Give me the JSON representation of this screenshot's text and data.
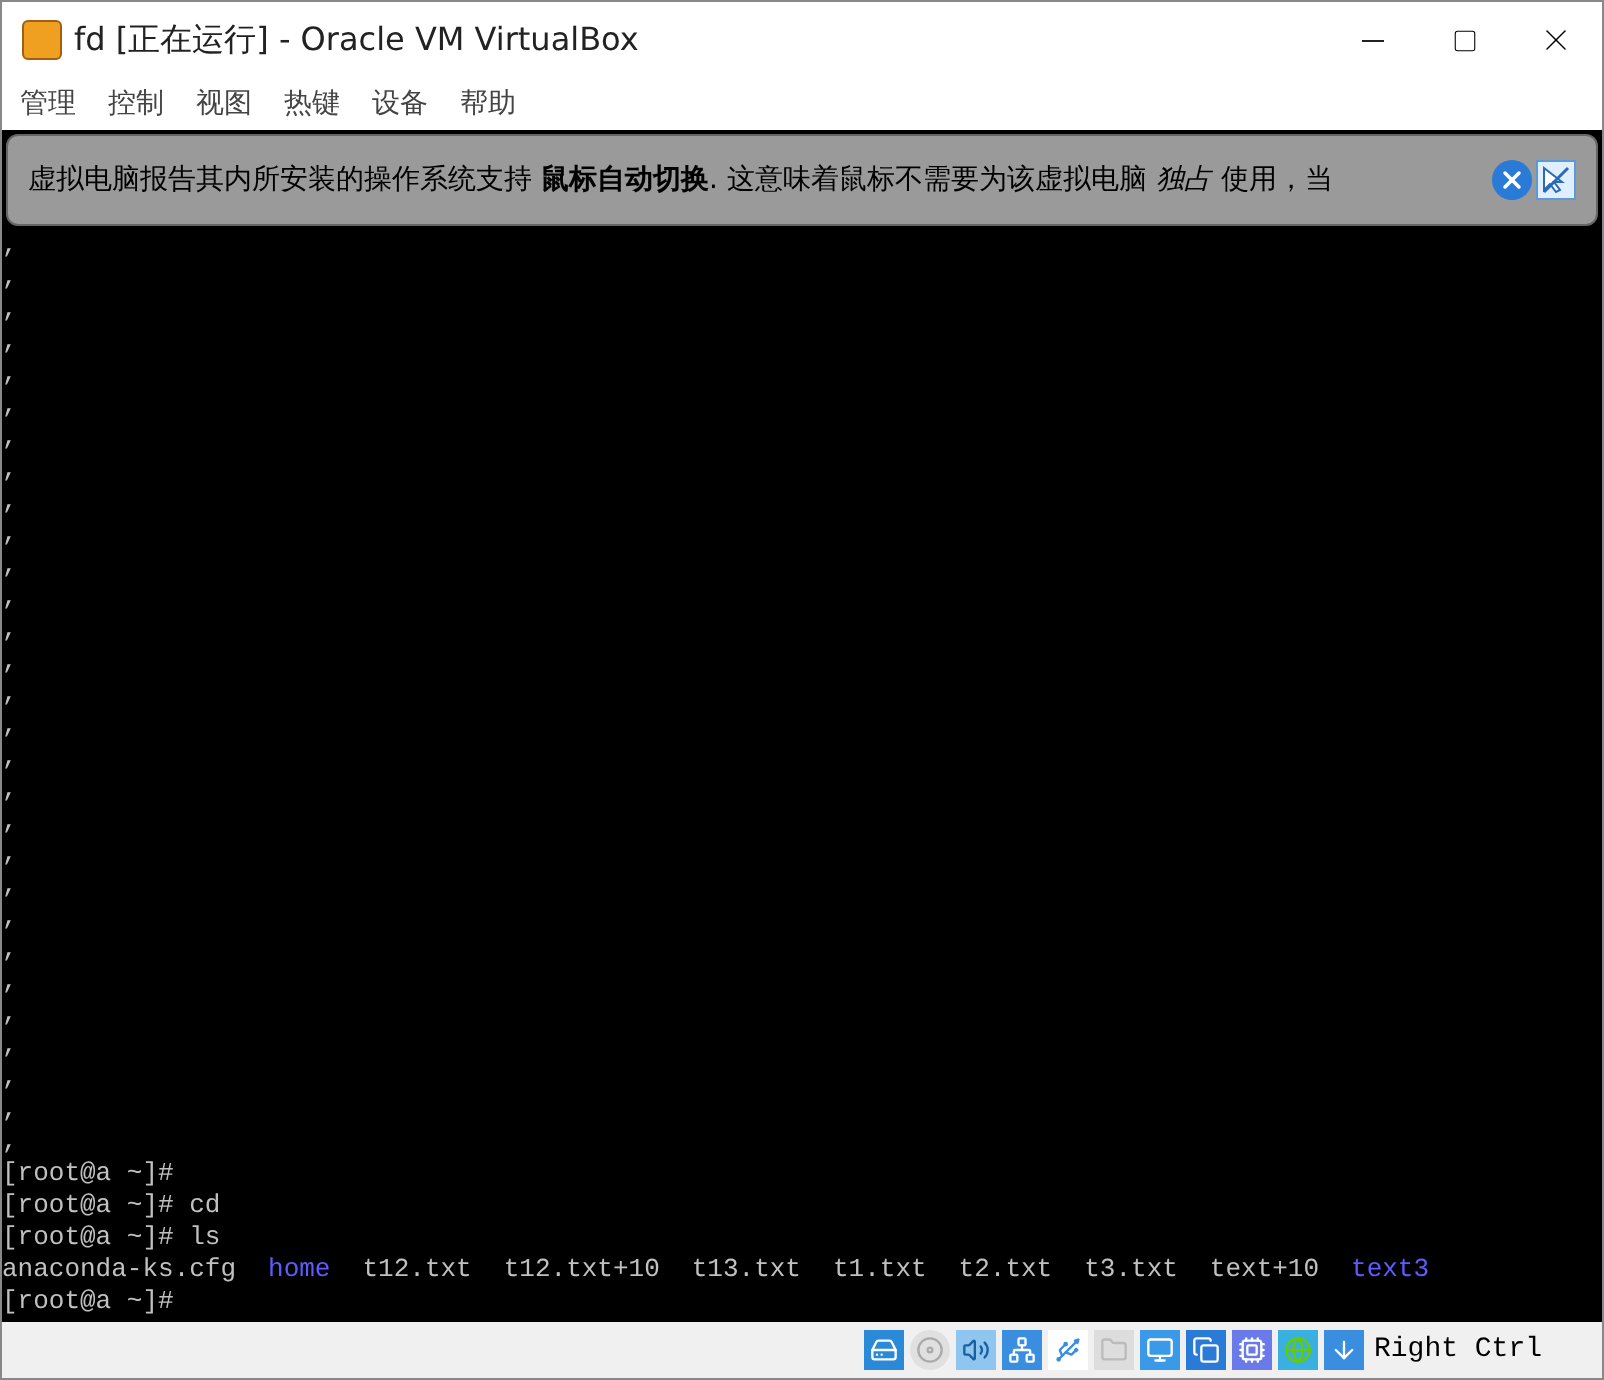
{
  "window": {
    "title": "fd [正在运行] - Oracle VM VirtualBox"
  },
  "menu": [
    "管理",
    "控制",
    "视图",
    "热键",
    "设备",
    "帮助"
  ],
  "notice": {
    "text": "虚拟电脑报告其内所安装的操作系统支持 **鼠标自动切换**. 这意味着鼠标不需要为该虚拟电脑 *独占* 使用，当"
  },
  "terminal": {
    "lines": [
      [
        {
          "kind": "plain",
          "text": ","
        }
      ],
      [
        {
          "kind": "plain",
          "text": ","
        }
      ],
      [
        {
          "kind": "plain",
          "text": ","
        }
      ],
      [
        {
          "kind": "plain",
          "text": ","
        }
      ],
      [
        {
          "kind": "plain",
          "text": ","
        }
      ],
      [
        {
          "kind": "plain",
          "text": ","
        }
      ],
      [
        {
          "kind": "plain",
          "text": ","
        }
      ],
      [
        {
          "kind": "plain",
          "text": ","
        }
      ],
      [
        {
          "kind": "plain",
          "text": ","
        }
      ],
      [
        {
          "kind": "plain",
          "text": ","
        }
      ],
      [
        {
          "kind": "plain",
          "text": ","
        }
      ],
      [
        {
          "kind": "plain",
          "text": ","
        }
      ],
      [
        {
          "kind": "plain",
          "text": ","
        }
      ],
      [
        {
          "kind": "plain",
          "text": ","
        }
      ],
      [
        {
          "kind": "plain",
          "text": ","
        }
      ],
      [
        {
          "kind": "plain",
          "text": ","
        }
      ],
      [
        {
          "kind": "plain",
          "text": ","
        }
      ],
      [
        {
          "kind": "plain",
          "text": ","
        }
      ],
      [
        {
          "kind": "plain",
          "text": ","
        }
      ],
      [
        {
          "kind": "plain",
          "text": ","
        }
      ],
      [
        {
          "kind": "plain",
          "text": ","
        }
      ],
      [
        {
          "kind": "plain",
          "text": ","
        }
      ],
      [
        {
          "kind": "plain",
          "text": ","
        }
      ],
      [
        {
          "kind": "plain",
          "text": ","
        }
      ],
      [
        {
          "kind": "plain",
          "text": ","
        }
      ],
      [
        {
          "kind": "plain",
          "text": ","
        }
      ],
      [
        {
          "kind": "plain",
          "text": ","
        }
      ],
      [
        {
          "kind": "plain",
          "text": ","
        }
      ],
      [
        {
          "kind": "plain",
          "text": ","
        }
      ],
      [
        {
          "kind": "plain",
          "text": "[root@a ~]#"
        }
      ],
      [
        {
          "kind": "plain",
          "text": "[root@a ~]# cd"
        }
      ],
      [
        {
          "kind": "plain",
          "text": "[root@a ~]# ls"
        }
      ],
      [
        {
          "kind": "plain",
          "text": "anaconda-ks.cfg"
        },
        {
          "kind": "dir",
          "text": "home"
        },
        {
          "kind": "plain",
          "text": "t12.txt"
        },
        {
          "kind": "plain",
          "text": "t12.txt+10"
        },
        {
          "kind": "plain",
          "text": "t13.txt"
        },
        {
          "kind": "plain",
          "text": "t1.txt"
        },
        {
          "kind": "plain",
          "text": "t2.txt"
        },
        {
          "kind": "plain",
          "text": "t3.txt"
        },
        {
          "kind": "plain",
          "text": "text+10"
        },
        {
          "kind": "dir",
          "text": "text3"
        }
      ],
      [
        {
          "kind": "plain",
          "text": "[root@a ~]#"
        }
      ]
    ]
  },
  "status_bar": {
    "host_key": "Right Ctrl"
  }
}
